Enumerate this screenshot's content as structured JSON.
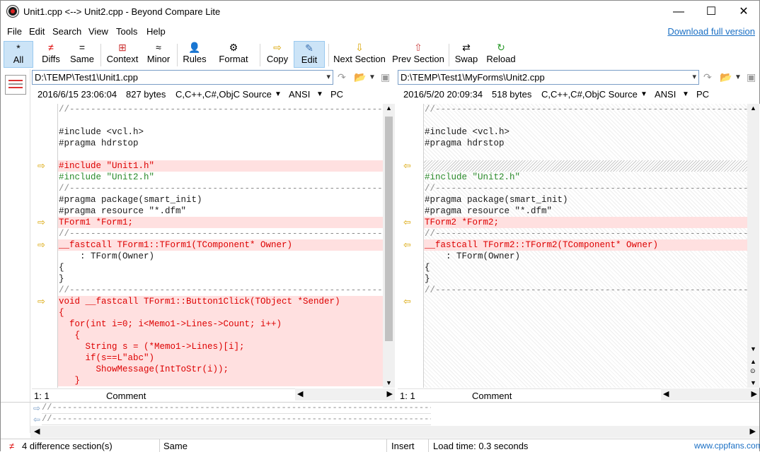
{
  "window": {
    "title": "Unit1.cpp <--> Unit2.cpp - Beyond Compare Lite",
    "minimize": "—",
    "maximize": "☐",
    "close": "✕"
  },
  "menu": {
    "items": [
      "File",
      "Edit",
      "Search",
      "View",
      "Tools",
      "Help"
    ],
    "download_link": "Download full version"
  },
  "toolbar": {
    "buttons": [
      {
        "label": "All",
        "icon": "*"
      },
      {
        "label": "Diffs",
        "icon": "≠"
      },
      {
        "label": "Same",
        "icon": "="
      },
      {
        "label": "Context",
        "icon": "⊞"
      },
      {
        "label": "Minor",
        "icon": "≈"
      },
      {
        "label": "Rules",
        "icon": "👤"
      },
      {
        "label": "Format",
        "icon": "⚙"
      },
      {
        "label": "Copy",
        "icon": "⇨"
      },
      {
        "label": "Edit",
        "icon": "✎"
      },
      {
        "label": "Next Section",
        "icon": "⇩"
      },
      {
        "label": "Prev Section",
        "icon": "⇧"
      },
      {
        "label": "Swap",
        "icon": "⇄"
      },
      {
        "label": "Reload",
        "icon": "↻"
      }
    ]
  },
  "left": {
    "path": "D:\\TEMP\\Test1\\Unit1.cpp",
    "date": "2016/6/15 23:06:04",
    "size": "827 bytes",
    "format": "C,C++,C#,ObjC Source",
    "encoding": "ANSI",
    "lineend": "PC",
    "position": "1: 1",
    "section": "Comment"
  },
  "right": {
    "path": "D:\\TEMP\\Test1\\MyForms\\Unit2.cpp",
    "date": "2016/5/20 20:09:34",
    "size": "518 bytes",
    "format": "C,C++,C#,ObjC Source",
    "encoding": "ANSI",
    "lineend": "PC",
    "position": "1: 1",
    "section": "Comment"
  },
  "left_lines": [
    {
      "t": "//---------------------------------------------------------------------------",
      "c": "gray",
      "k": ""
    },
    {
      "t": "",
      "c": "",
      "k": ""
    },
    {
      "t": "#include <vcl.h>",
      "c": "dark",
      "k": ""
    },
    {
      "t": "#pragma hdrstop",
      "c": "dark",
      "k": ""
    },
    {
      "t": "",
      "c": "",
      "k": ""
    },
    {
      "t": "#include \"Unit1.h\"",
      "c": "red",
      "k": "diff"
    },
    {
      "t": "#include \"Unit2.h\"",
      "c": "green",
      "k": ""
    },
    {
      "t": "//---------------------------------------------------------------------------",
      "c": "gray",
      "k": ""
    },
    {
      "t": "#pragma package(smart_init)",
      "c": "dark",
      "k": ""
    },
    {
      "t": "#pragma resource \"*.dfm\"",
      "c": "dark",
      "k": ""
    },
    {
      "t": "TForm1 *Form1;",
      "c": "red",
      "k": "diff"
    },
    {
      "t": "//---------------------------------------------------------------------------",
      "c": "gray",
      "k": ""
    },
    {
      "t": "__fastcall TForm1::TForm1(TComponent* Owner)",
      "c": "red",
      "k": "diff"
    },
    {
      "t": "    : TForm(Owner)",
      "c": "dark",
      "k": ""
    },
    {
      "t": "{",
      "c": "dark",
      "k": ""
    },
    {
      "t": "}",
      "c": "dark",
      "k": ""
    },
    {
      "t": "//---------------------------------------------------------------------------",
      "c": "gray",
      "k": ""
    },
    {
      "t": "void __fastcall TForm1::Button1Click(TObject *Sender)",
      "c": "red",
      "k": "diff"
    },
    {
      "t": "{",
      "c": "red",
      "k": "diff"
    },
    {
      "t": "  for(int i=0; i<Memo1->Lines->Count; i++)",
      "c": "red",
      "k": "diff"
    },
    {
      "t": "   {",
      "c": "red",
      "k": "diff"
    },
    {
      "t": "     String s = (*Memo1->Lines)[i];",
      "c": "red",
      "k": "diff"
    },
    {
      "t": "     if(s==L\"abc\")",
      "c": "red",
      "k": "diff"
    },
    {
      "t": "       ShowMessage(IntToStr(i));",
      "c": "red",
      "k": "diff"
    },
    {
      "t": "   }",
      "c": "red",
      "k": "diff"
    }
  ],
  "right_lines": [
    {
      "t": "//---------------------------------------------------------------------------",
      "c": "gray",
      "k": ""
    },
    {
      "t": "",
      "c": "",
      "k": ""
    },
    {
      "t": "#include <vcl.h>",
      "c": "dark",
      "k": ""
    },
    {
      "t": "#pragma hdrstop",
      "c": "dark",
      "k": ""
    },
    {
      "t": "",
      "c": "",
      "k": ""
    },
    {
      "t": "",
      "c": "",
      "k": "hatch"
    },
    {
      "t": "#include \"Unit2.h\"",
      "c": "green",
      "k": ""
    },
    {
      "t": "//---------------------------------------------------------------------------",
      "c": "gray",
      "k": ""
    },
    {
      "t": "#pragma package(smart_init)",
      "c": "dark",
      "k": ""
    },
    {
      "t": "#pragma resource \"*.dfm\"",
      "c": "dark",
      "k": ""
    },
    {
      "t": "TForm2 *Form2;",
      "c": "red",
      "k": "diff"
    },
    {
      "t": "//---------------------------------------------------------------------------",
      "c": "gray",
      "k": ""
    },
    {
      "t": "__fastcall TForm2::TForm2(TComponent* Owner)",
      "c": "red",
      "k": "diff"
    },
    {
      "t": "    : TForm(Owner)",
      "c": "dark",
      "k": ""
    },
    {
      "t": "{",
      "c": "dark",
      "k": ""
    },
    {
      "t": "}",
      "c": "dark",
      "k": ""
    },
    {
      "t": "//---------------------------------------------------------------------------",
      "c": "gray",
      "k": ""
    }
  ],
  "left_markers": [
    5,
    10,
    12,
    17
  ],
  "right_markers": [
    5,
    10,
    12,
    17
  ],
  "mini_lines": [
    "//---------------------------------------------------------------------------",
    "//---------------------------------------------------------------------------"
  ],
  "statusbar": {
    "diff_count": "4 difference section(s)",
    "same": "Same",
    "mode": "Insert",
    "load_time": "Load time: 0.3 seconds",
    "site": "www.cppfans.com"
  },
  "colors": {
    "diff_bg": "#ffe0e0",
    "diff_text": "#dd0000",
    "marker": "#d9a400",
    "link": "#1a6fc4"
  }
}
